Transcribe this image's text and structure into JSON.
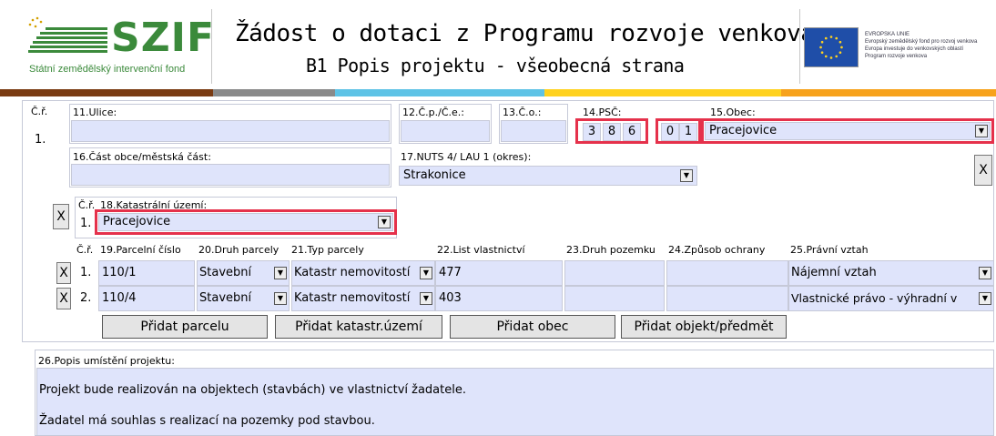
{
  "header": {
    "logo_text": "SZIF",
    "logo_subtitle": "Státní zemědělský intervenční fond",
    "title": "Žádost o dotaci z Programu rozvoje venkova",
    "subtitle": "B1 Popis projektu - všeobecná strana",
    "eu_lines": [
      "EVROPSKÁ UNIE",
      "Evropský zemědělský fond pro rozvoj venkova",
      "Evropa investuje do venkovských oblastí",
      "Program rozvoje venkova"
    ],
    "brand_color": "#3b8a3b",
    "band_colors": [
      "#7a3b12",
      "#8a8a8a",
      "#5ec3e6",
      "#ffd21f",
      "#f7a21b"
    ]
  },
  "address": {
    "cr_label": "Č.ř.",
    "row_no": "1.",
    "ulice_label": "11.Ulice:",
    "ulice_value": "",
    "cp_label": "12.Č.p./Č.e.:",
    "co_label": "13.Č.o.:",
    "psc_label": "14.PSČ:",
    "psc_digits": [
      "3",
      "8",
      "6",
      "0",
      "1"
    ],
    "obec_label": "15.Obec:",
    "obec_value": "Pracejovice",
    "cast_label": "16.Část obce/městská část:",
    "nuts_label": "17.NUTS 4/ LAU 1 (okres):",
    "nuts_value": "Strakonice",
    "x_label": "X"
  },
  "katastr": {
    "cr_label": "Č.ř.",
    "row_no": "1.",
    "label": "18.Katastrální území:",
    "value": "Pracejovice",
    "x_label": "X"
  },
  "parcels": {
    "headers": [
      "Č.ř.",
      "19.Parcelní číslo",
      "20.Druh parcely",
      "21.Typ parcely",
      "22.List vlastnictví",
      "23.Druh pozemku",
      "24.Způsob ochrany",
      "25.Právní vztah"
    ],
    "rows": [
      {
        "x": "X",
        "no": "1.",
        "cislo": "110/1",
        "druh": "Stavební",
        "typ": "Katastr nemovitostí",
        "list": "477",
        "pozemek": "",
        "ochrana": "",
        "vztah": "Nájemní vztah"
      },
      {
        "x": "X",
        "no": "2.",
        "cislo": "110/4",
        "druh": "Stavební",
        "typ": "Katastr nemovitostí",
        "list": "403",
        "pozemek": "",
        "ochrana": "",
        "vztah": "Vlastnické právo - výhradní v"
      }
    ]
  },
  "buttons": {
    "add_parcel": "Přidat parcelu",
    "add_katastr": "Přidat katastr.území",
    "add_obec": "Přidat obec",
    "add_object": "Přidat objekt/předmět"
  },
  "popis": {
    "label": "26.Popis umístění projektu:",
    "line1": "Projekt bude realizován na objektech (stavbách) ve vlastnictví žadatele.",
    "line2": "Žadatel má souhlas s realizací na pozemky pod stavbou."
  }
}
